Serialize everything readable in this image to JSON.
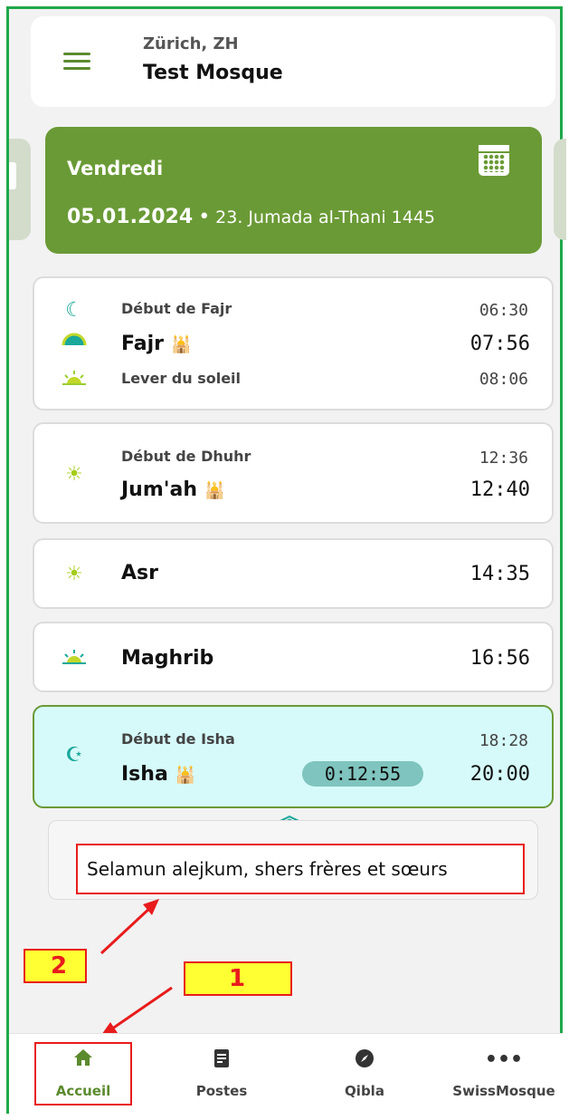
{
  "header": {
    "city": "Zürich, ZH",
    "mosque": "Test Mosque"
  },
  "date_card": {
    "weekday": "Vendredi",
    "gregorian": "05.01.2024",
    "separator": "•",
    "hijri": "23. Jumada al-Thani 1445"
  },
  "prayers": {
    "fajr": {
      "start_label": "Début de Fajr",
      "start_time": "06:30",
      "name": "Fajr",
      "time": "07:56",
      "sunrise_label": "Lever du soleil",
      "sunrise_time": "08:06"
    },
    "dhuhr": {
      "start_label": "Début de Dhuhr",
      "start_time": "12:36",
      "name": "Jum'ah",
      "time": "12:40"
    },
    "asr": {
      "name": "Asr",
      "time": "14:35"
    },
    "maghrib": {
      "name": "Maghrib",
      "time": "16:56"
    },
    "isha": {
      "start_label": "Début de Isha",
      "start_time": "18:28",
      "name": "Isha",
      "time": "20:00",
      "countdown": "0:12:55"
    }
  },
  "message": "Selamun alejkum, shers frères et sœurs",
  "annotations": {
    "badge1": "1",
    "badge2": "2"
  },
  "nav": {
    "items": [
      {
        "label": "Accueil",
        "icon": "home-icon"
      },
      {
        "label": "Postes",
        "icon": "document-icon"
      },
      {
        "label": "Qibla",
        "icon": "compass-icon"
      },
      {
        "label": "SwissMosque",
        "icon": "more-icon"
      }
    ]
  },
  "colors": {
    "accent_green": "#6a9a36",
    "teal": "#1aa89a",
    "active_bg": "#d6fafa",
    "annotation_red": "#e81c1c",
    "annotation_yellow": "#ffff33"
  }
}
